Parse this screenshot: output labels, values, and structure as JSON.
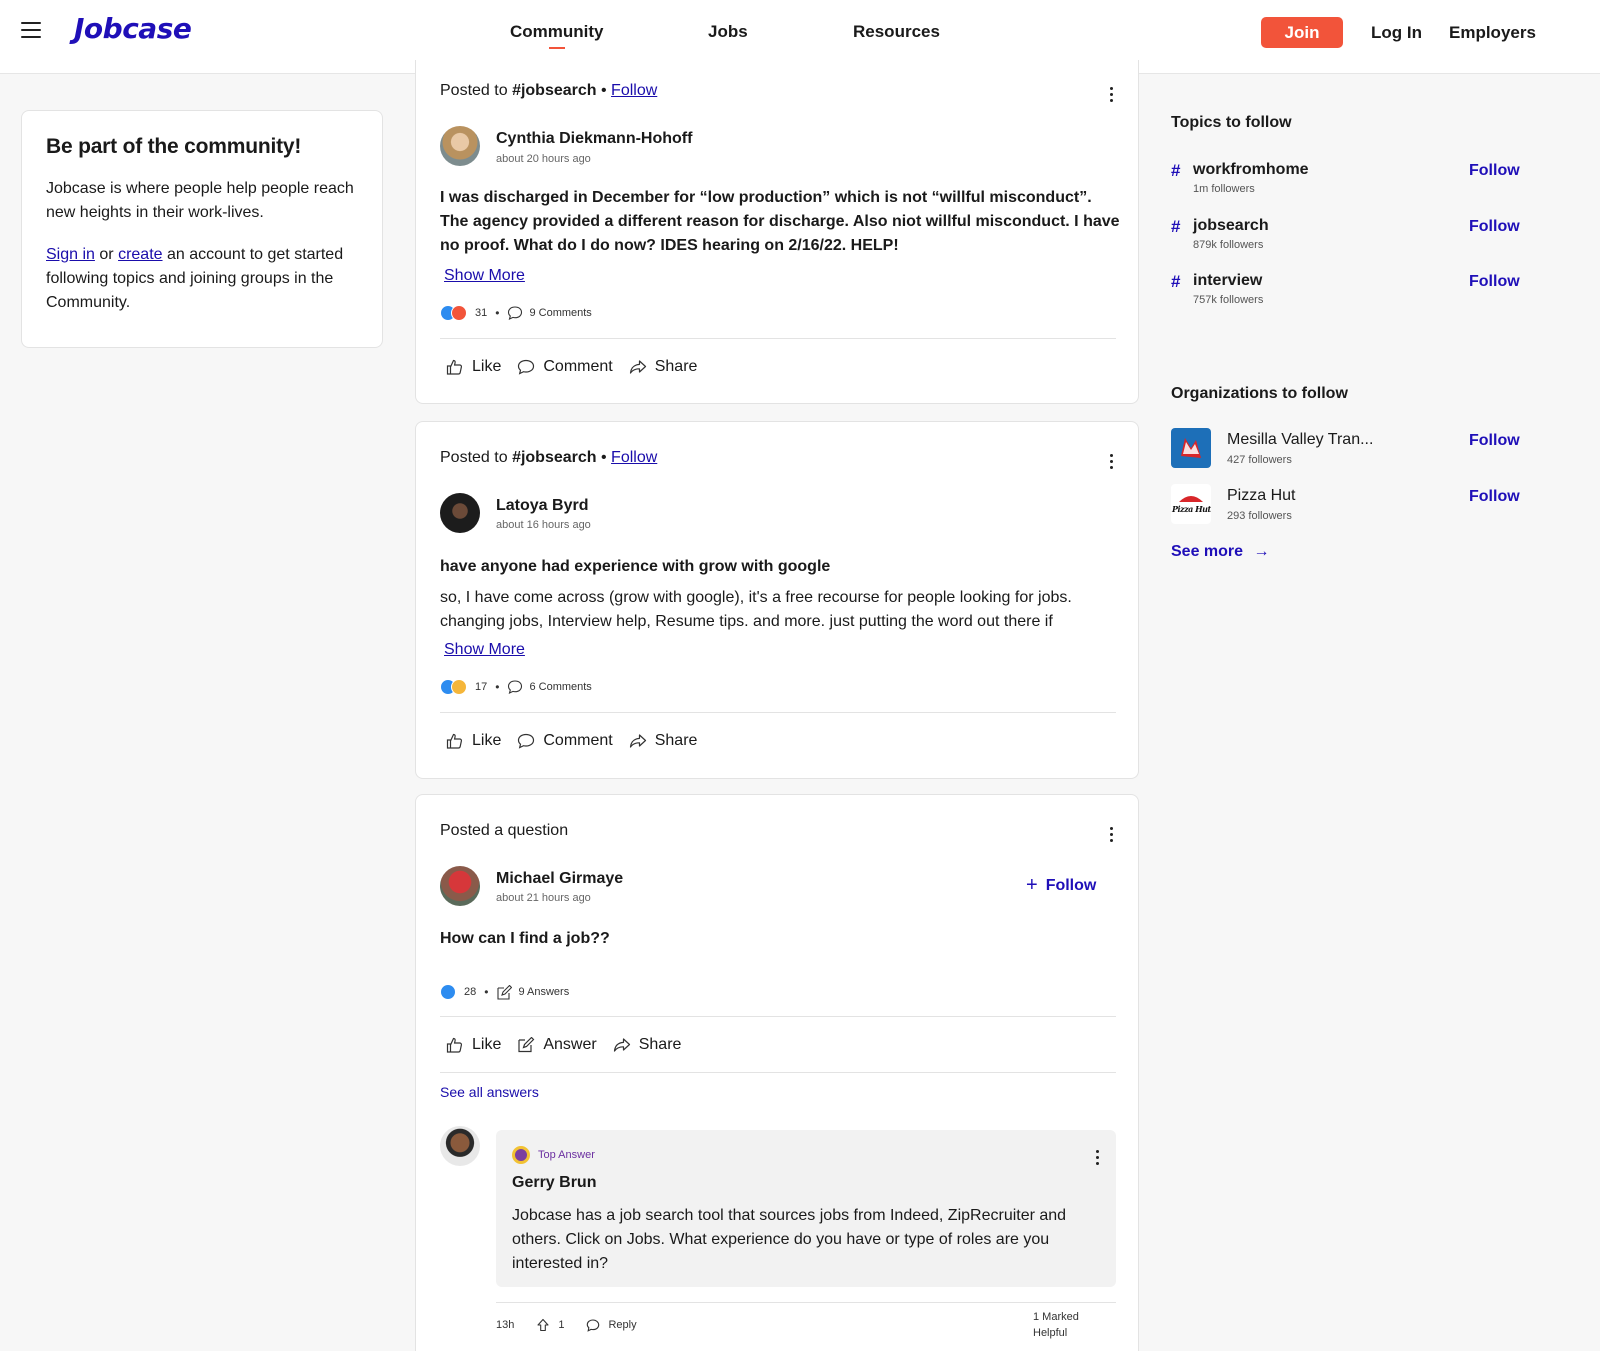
{
  "header": {
    "logo": "Jobcase",
    "nav": [
      "Community",
      "Jobs",
      "Resources"
    ],
    "join": "Join",
    "login": "Log In",
    "employers": "Employers"
  },
  "left": {
    "title": "Be part of the community!",
    "intro": "Jobcase is where people help people reach new heights in their work-lives.",
    "sign_in": "Sign in",
    "or": "or",
    "create": "create",
    "rest": "an account to get started following topics and joining groups in the Community."
  },
  "posts": [
    {
      "posted_prefix": "Posted to",
      "tag": "#jobsearch",
      "follow": "Follow",
      "author": "Cynthia Diekmann-Hohoff",
      "time": "about 20 hours ago",
      "body": "I was discharged in December for “low production” which is not “willful misconduct”. The agency provided a different reason for discharge. Also niot willful misconduct. I have no proof. What do I do now? IDES hearing on 2/16/22. HELP!",
      "show_more": "Show More",
      "reactions": "31",
      "comments": "9 Comments",
      "actions": [
        "Like",
        "Comment",
        "Share"
      ]
    },
    {
      "posted_prefix": "Posted to",
      "tag": "#jobsearch",
      "follow": "Follow",
      "author": "Latoya Byrd",
      "time": "about 16 hours ago",
      "title": "have anyone had experience with grow with google",
      "body": "so, I have come across (grow with google), it's a free recourse for people looking for jobs. changing jobs, Interview help, Resume tips. and more. just putting the word out there if",
      "show_more": "Show More",
      "reactions": "17",
      "comments": "6 Comments",
      "actions": [
        "Like",
        "Comment",
        "Share"
      ]
    },
    {
      "posted_prefix": "Posted a question",
      "author": "Michael Girmaye",
      "time": "about 21 hours ago",
      "follow": "Follow",
      "title": "How can I find a job??",
      "reactions": "28",
      "answers": "9 Answers",
      "actions": [
        "Like",
        "Answer",
        "Share"
      ],
      "see_all": "See all answers",
      "top_answer": {
        "badge": "Top Answer",
        "author": "Gerry Brun",
        "body": "Jobcase has a job search tool that sources jobs from Indeed, ZipRecruiter and others. Click on Jobs. What experience do you have or type of roles are you interested in?",
        "time": "13h",
        "votes": "1",
        "reply": "Reply",
        "marked_line1": "1 Marked",
        "marked_line2": "Helpful"
      }
    }
  ],
  "rail": {
    "topics_title": "Topics to follow",
    "topics": [
      {
        "name": "workfromhome",
        "followers": "1m followers",
        "follow": "Follow"
      },
      {
        "name": "jobsearch",
        "followers": "879k followers",
        "follow": "Follow"
      },
      {
        "name": "interview",
        "followers": "757k followers",
        "follow": "Follow"
      }
    ],
    "orgs_title": "Organizations to follow",
    "orgs": [
      {
        "name": "Mesilla Valley Tran...",
        "followers": "427 followers",
        "follow": "Follow"
      },
      {
        "name": "Pizza Hut",
        "followers": "293 followers",
        "follow": "Follow",
        "logo_text": "Pizza Hut"
      }
    ],
    "see_more": "See more"
  },
  "colors": {
    "brand": "#1f0fb8",
    "join": "#f2543a",
    "link": "#1a0dab"
  }
}
